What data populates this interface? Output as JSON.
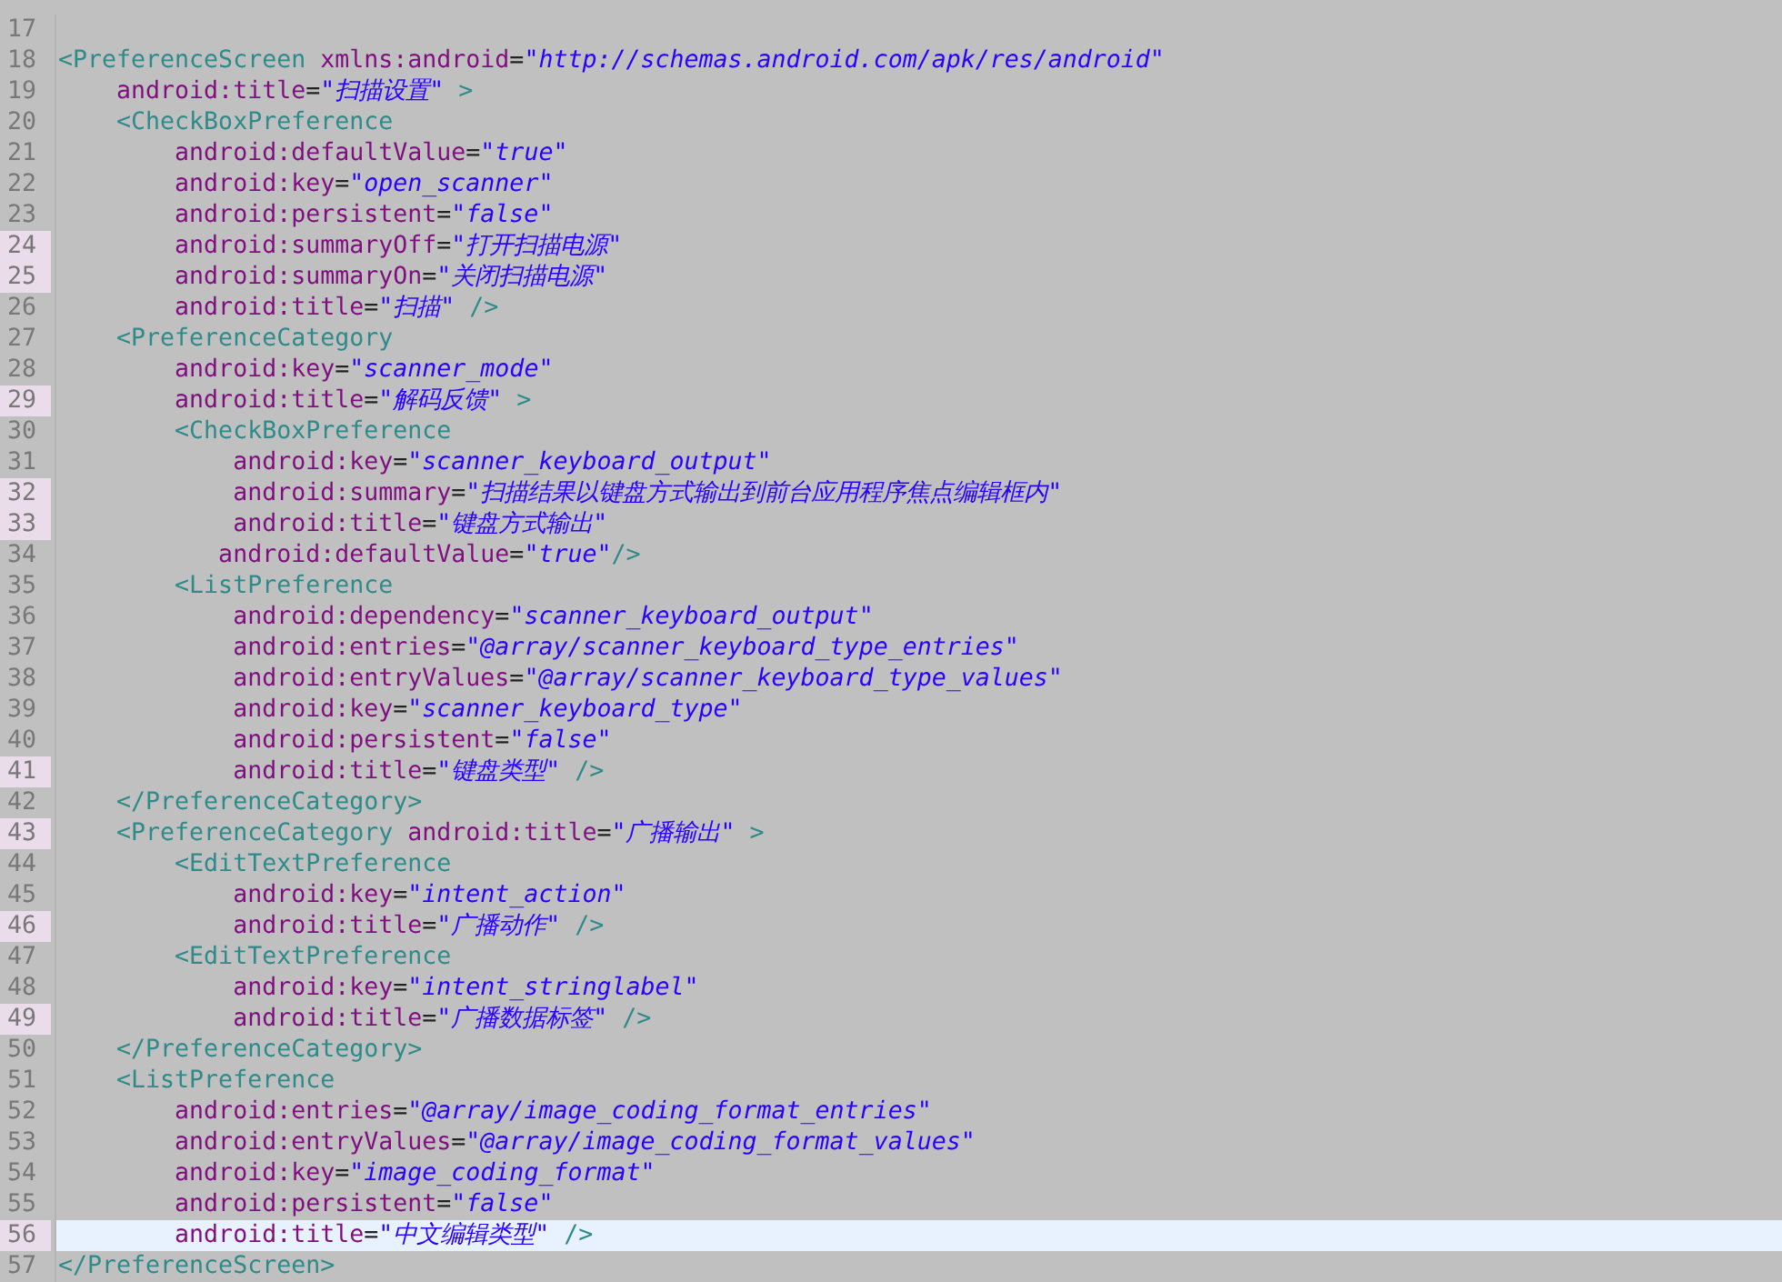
{
  "editor": {
    "lines": [
      {
        "number": "17",
        "changed": false,
        "current": false
      },
      {
        "number": "18",
        "changed": false,
        "current": false,
        "tokens": [
          {
            "kind": "tag",
            "text": "<PreferenceScreen"
          },
          {
            "kind": "attr",
            "text": " xmlns:android"
          },
          {
            "kind": "eq",
            "text": "="
          },
          {
            "kind": "str",
            "text": "\"http://schemas.android.com/apk/res/android\""
          }
        ]
      },
      {
        "number": "19",
        "changed": false,
        "current": false,
        "tokens": [
          {
            "kind": "attr",
            "text": "    android:title"
          },
          {
            "kind": "eq",
            "text": "="
          },
          {
            "kind": "str",
            "text": "\"扫描设置\""
          },
          {
            "kind": "tag",
            "text": " >"
          }
        ]
      },
      {
        "number": "20",
        "changed": false,
        "current": false,
        "tokens": [
          {
            "kind": "tag",
            "text": "    <CheckBoxPreference"
          }
        ]
      },
      {
        "number": "21",
        "changed": false,
        "current": false,
        "tokens": [
          {
            "kind": "attr",
            "text": "        android:defaultValue"
          },
          {
            "kind": "eq",
            "text": "="
          },
          {
            "kind": "str",
            "text": "\"true\""
          }
        ]
      },
      {
        "number": "22",
        "changed": false,
        "current": false,
        "tokens": [
          {
            "kind": "attr",
            "text": "        android:key"
          },
          {
            "kind": "eq",
            "text": "="
          },
          {
            "kind": "str",
            "text": "\"open_scanner\""
          }
        ]
      },
      {
        "number": "23",
        "changed": false,
        "current": false,
        "tokens": [
          {
            "kind": "attr",
            "text": "        android:persistent"
          },
          {
            "kind": "eq",
            "text": "="
          },
          {
            "kind": "str",
            "text": "\"false\""
          }
        ]
      },
      {
        "number": "24",
        "changed": true,
        "current": false,
        "tokens": [
          {
            "kind": "attr",
            "text": "        android:summaryOff"
          },
          {
            "kind": "eq",
            "text": "="
          },
          {
            "kind": "str",
            "text": "\"打开扫描电源\""
          }
        ]
      },
      {
        "number": "25",
        "changed": true,
        "current": false,
        "tokens": [
          {
            "kind": "attr",
            "text": "        android:summaryOn"
          },
          {
            "kind": "eq",
            "text": "="
          },
          {
            "kind": "str",
            "text": "\"关闭扫描电源\""
          }
        ]
      },
      {
        "number": "26",
        "changed": false,
        "current": false,
        "tokens": [
          {
            "kind": "attr",
            "text": "        android:title"
          },
          {
            "kind": "eq",
            "text": "="
          },
          {
            "kind": "str",
            "text": "\"扫描\""
          },
          {
            "kind": "tag",
            "text": " />"
          }
        ]
      },
      {
        "number": "27",
        "changed": false,
        "current": false,
        "tokens": [
          {
            "kind": "tag",
            "text": "    <PreferenceCategory"
          }
        ]
      },
      {
        "number": "28",
        "changed": false,
        "current": false,
        "tokens": [
          {
            "kind": "attr",
            "text": "        android:key"
          },
          {
            "kind": "eq",
            "text": "="
          },
          {
            "kind": "str",
            "text": "\"scanner_mode\""
          }
        ]
      },
      {
        "number": "29",
        "changed": true,
        "current": false,
        "tokens": [
          {
            "kind": "attr",
            "text": "        android:title"
          },
          {
            "kind": "eq",
            "text": "="
          },
          {
            "kind": "str",
            "text": "\"解码反馈\""
          },
          {
            "kind": "tag",
            "text": " >"
          }
        ]
      },
      {
        "number": "30",
        "changed": false,
        "current": false,
        "tokens": [
          {
            "kind": "tag",
            "text": "        <CheckBoxPreference"
          }
        ]
      },
      {
        "number": "31",
        "changed": false,
        "current": false,
        "tokens": [
          {
            "kind": "attr",
            "text": "            android:key"
          },
          {
            "kind": "eq",
            "text": "="
          },
          {
            "kind": "str",
            "text": "\"scanner_keyboard_output\""
          }
        ]
      },
      {
        "number": "32",
        "changed": true,
        "current": false,
        "tokens": [
          {
            "kind": "attr",
            "text": "            android:summary"
          },
          {
            "kind": "eq",
            "text": "="
          },
          {
            "kind": "str",
            "text": "\"扫描结果以键盘方式输出到前台应用程序焦点编辑框内\""
          }
        ]
      },
      {
        "number": "33",
        "changed": true,
        "current": false,
        "tokens": [
          {
            "kind": "attr",
            "text": "            android:title"
          },
          {
            "kind": "eq",
            "text": "="
          },
          {
            "kind": "str",
            "text": "\"键盘方式输出\""
          }
        ]
      },
      {
        "number": "34",
        "changed": false,
        "current": false,
        "tokens": [
          {
            "kind": "attr",
            "text": "           android:defaultValue"
          },
          {
            "kind": "eq",
            "text": "="
          },
          {
            "kind": "str",
            "text": "\"true\""
          },
          {
            "kind": "tag",
            "text": "/>"
          }
        ]
      },
      {
        "number": "35",
        "changed": false,
        "current": false,
        "tokens": [
          {
            "kind": "tag",
            "text": "        <ListPreference"
          }
        ]
      },
      {
        "number": "36",
        "changed": false,
        "current": false,
        "tokens": [
          {
            "kind": "attr",
            "text": "            android:dependency"
          },
          {
            "kind": "eq",
            "text": "="
          },
          {
            "kind": "str",
            "text": "\"scanner_keyboard_output\""
          }
        ]
      },
      {
        "number": "37",
        "changed": false,
        "current": false,
        "tokens": [
          {
            "kind": "attr",
            "text": "            android:entries"
          },
          {
            "kind": "eq",
            "text": "="
          },
          {
            "kind": "str",
            "text": "\"@array/scanner_keyboard_type_entries\""
          }
        ]
      },
      {
        "number": "38",
        "changed": false,
        "current": false,
        "tokens": [
          {
            "kind": "attr",
            "text": "            android:entryValues"
          },
          {
            "kind": "eq",
            "text": "="
          },
          {
            "kind": "str",
            "text": "\"@array/scanner_keyboard_type_values\""
          }
        ]
      },
      {
        "number": "39",
        "changed": false,
        "current": false,
        "tokens": [
          {
            "kind": "attr",
            "text": "            android:key"
          },
          {
            "kind": "eq",
            "text": "="
          },
          {
            "kind": "str",
            "text": "\"scanner_keyboard_type\""
          }
        ]
      },
      {
        "number": "40",
        "changed": false,
        "current": false,
        "tokens": [
          {
            "kind": "attr",
            "text": "            android:persistent"
          },
          {
            "kind": "eq",
            "text": "="
          },
          {
            "kind": "str",
            "text": "\"false\""
          }
        ]
      },
      {
        "number": "41",
        "changed": true,
        "current": false,
        "tokens": [
          {
            "kind": "attr",
            "text": "            android:title"
          },
          {
            "kind": "eq",
            "text": "="
          },
          {
            "kind": "str",
            "text": "\"键盘类型\""
          },
          {
            "kind": "tag",
            "text": " />"
          }
        ]
      },
      {
        "number": "42",
        "changed": false,
        "current": false,
        "tokens": [
          {
            "kind": "tag",
            "text": "    </PreferenceCategory>"
          }
        ]
      },
      {
        "number": "43",
        "changed": true,
        "current": false,
        "tokens": [
          {
            "kind": "tag",
            "text": "    <PreferenceCategory"
          },
          {
            "kind": "attr",
            "text": " android:title"
          },
          {
            "kind": "eq",
            "text": "="
          },
          {
            "kind": "str",
            "text": "\"广播输出\""
          },
          {
            "kind": "tag",
            "text": " >"
          }
        ]
      },
      {
        "number": "44",
        "changed": false,
        "current": false,
        "tokens": [
          {
            "kind": "tag",
            "text": "        <EditTextPreference"
          }
        ]
      },
      {
        "number": "45",
        "changed": false,
        "current": false,
        "tokens": [
          {
            "kind": "attr",
            "text": "            android:key"
          },
          {
            "kind": "eq",
            "text": "="
          },
          {
            "kind": "str",
            "text": "\"intent_action\""
          }
        ]
      },
      {
        "number": "46",
        "changed": true,
        "current": false,
        "tokens": [
          {
            "kind": "attr",
            "text": "            android:title"
          },
          {
            "kind": "eq",
            "text": "="
          },
          {
            "kind": "str",
            "text": "\"广播动作\""
          },
          {
            "kind": "tag",
            "text": " />"
          }
        ]
      },
      {
        "number": "47",
        "changed": false,
        "current": false,
        "tokens": [
          {
            "kind": "tag",
            "text": "        <EditTextPreference"
          }
        ]
      },
      {
        "number": "48",
        "changed": false,
        "current": false,
        "tokens": [
          {
            "kind": "attr",
            "text": "            android:key"
          },
          {
            "kind": "eq",
            "text": "="
          },
          {
            "kind": "str",
            "text": "\"intent_stringlabel\""
          }
        ]
      },
      {
        "number": "49",
        "changed": true,
        "current": false,
        "tokens": [
          {
            "kind": "attr",
            "text": "            android:title"
          },
          {
            "kind": "eq",
            "text": "="
          },
          {
            "kind": "str",
            "text": "\"广播数据标签\""
          },
          {
            "kind": "tag",
            "text": " />"
          }
        ]
      },
      {
        "number": "50",
        "changed": false,
        "current": false,
        "tokens": [
          {
            "kind": "tag",
            "text": "    </PreferenceCategory>"
          }
        ]
      },
      {
        "number": "51",
        "changed": false,
        "current": false,
        "tokens": [
          {
            "kind": "tag",
            "text": "    <ListPreference"
          }
        ]
      },
      {
        "number": "52",
        "changed": false,
        "current": false,
        "tokens": [
          {
            "kind": "attr",
            "text": "        android:entries"
          },
          {
            "kind": "eq",
            "text": "="
          },
          {
            "kind": "str",
            "text": "\"@array/image_coding_format_entries\""
          }
        ]
      },
      {
        "number": "53",
        "changed": false,
        "current": false,
        "tokens": [
          {
            "kind": "attr",
            "text": "        android:entryValues"
          },
          {
            "kind": "eq",
            "text": "="
          },
          {
            "kind": "str",
            "text": "\"@array/image_coding_format_values\""
          }
        ]
      },
      {
        "number": "54",
        "changed": false,
        "current": false,
        "tokens": [
          {
            "kind": "attr",
            "text": "        android:key"
          },
          {
            "kind": "eq",
            "text": "="
          },
          {
            "kind": "str",
            "text": "\"image_coding_format\""
          }
        ]
      },
      {
        "number": "55",
        "changed": false,
        "current": false,
        "tokens": [
          {
            "kind": "attr",
            "text": "        android:persistent"
          },
          {
            "kind": "eq",
            "text": "="
          },
          {
            "kind": "str",
            "text": "\"false\""
          }
        ]
      },
      {
        "number": "56",
        "changed": true,
        "current": true,
        "tokens": [
          {
            "kind": "attr",
            "text": "        android:title"
          },
          {
            "kind": "eq",
            "text": "="
          },
          {
            "kind": "str",
            "text": "\"中文编辑类型\""
          },
          {
            "kind": "tag",
            "text": " />"
          }
        ]
      },
      {
        "number": "57",
        "changed": false,
        "current": false,
        "tokens": [
          {
            "kind": "tag",
            "text": "</PreferenceScreen>"
          }
        ]
      }
    ]
  }
}
